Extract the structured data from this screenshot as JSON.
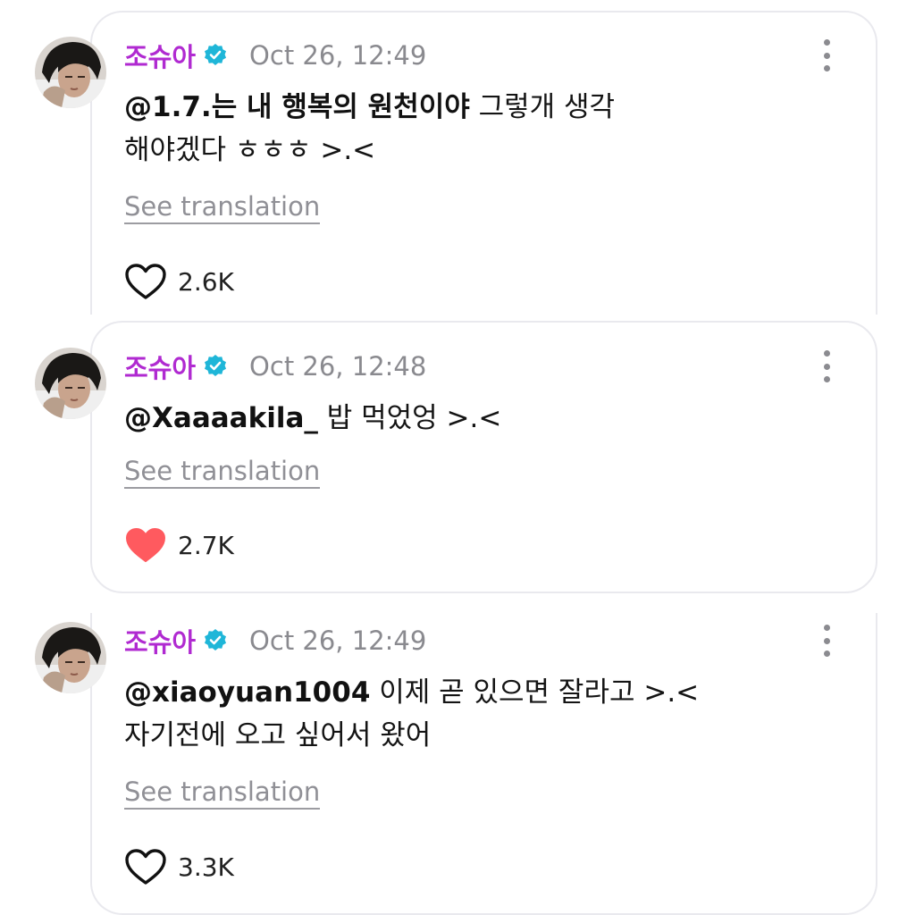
{
  "posts": [
    {
      "username": "조슈아",
      "verified": true,
      "timestamp": "Oct 26, 12:49",
      "mention": "@1.7.는 내 행복의 원천이야",
      "text_line1": " 그렇개 생각",
      "text_line2": "해야겠다 ㅎㅎㅎ >.<",
      "translate_label": "See translation",
      "likes": "2.6K",
      "liked": false
    },
    {
      "username": "조슈아",
      "verified": true,
      "timestamp": "Oct 26, 12:48",
      "mention": "@Xaaaakila_",
      "text_line1": " 밥 먹었엉 >.<",
      "text_line2": "",
      "translate_label": "See translation",
      "likes": "2.7K",
      "liked": true
    },
    {
      "username": "조슈아",
      "verified": true,
      "timestamp": "Oct 26, 12:49",
      "mention": "@xiaoyuan1004",
      "text_line1": " 이제 곧 있으면 잘라고 >.<",
      "text_line2": "자기전에 오고 싶어서 왔어",
      "translate_label": "See translation",
      "likes": "3.3K",
      "liked": false
    }
  ],
  "colors": {
    "username": "#b02ad1",
    "verified_badge": "#1fb6d8",
    "liked_heart": "#ff5a5f",
    "muted_text": "#8a8a8f"
  },
  "icons": [
    "verified-icon",
    "more-icon",
    "heart-icon",
    "heart-filled-icon"
  ]
}
